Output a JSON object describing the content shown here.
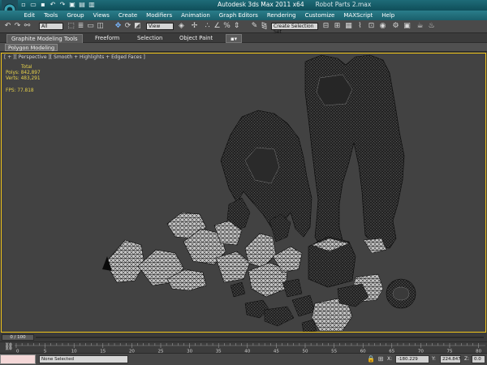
{
  "window": {
    "title": "Autodesk 3ds Max  2011 x64",
    "filename": "Robot Parts 2.max"
  },
  "menu": [
    "Edit",
    "Tools",
    "Group",
    "Views",
    "Create",
    "Modifiers",
    "Animation",
    "Graph Editors",
    "Rendering",
    "Customize",
    "MAXScript",
    "Help"
  ],
  "toolbar": {
    "selection_filter": "All",
    "reference_coord": "View",
    "named_selection": "Create Selection Set"
  },
  "ribbon": {
    "tabs": [
      "Graphite Modeling Tools",
      "Freeform",
      "Selection",
      "Object Paint"
    ],
    "panel": "Polygon Modeling"
  },
  "viewport": {
    "label": "[ + ][ Perspective ][ Smooth + Highlights + Edged Faces ]",
    "stats": {
      "total_label": "Total",
      "polys_label": "Polys:",
      "polys": "842,897",
      "verts_label": "Verts:",
      "verts": "483,291",
      "fps_label": "FPS:",
      "fps": "77.818"
    },
    "accent_color": "#f0c419",
    "wire_color": "#0a0a0a",
    "mesh_color": "#bdbdbd"
  },
  "timeline": {
    "frame": "0 / 100",
    "ticks": [
      "0",
      "5",
      "10",
      "15",
      "20",
      "25",
      "30",
      "35",
      "40",
      "45",
      "50",
      "55",
      "60",
      "65",
      "70",
      "75",
      "80"
    ]
  },
  "status": {
    "selection": "None Selected",
    "x_label": "X:",
    "x": "-180.229",
    "y_label": "Y:",
    "y": "224.847",
    "z_label": "Z:",
    "z": "0.0"
  }
}
